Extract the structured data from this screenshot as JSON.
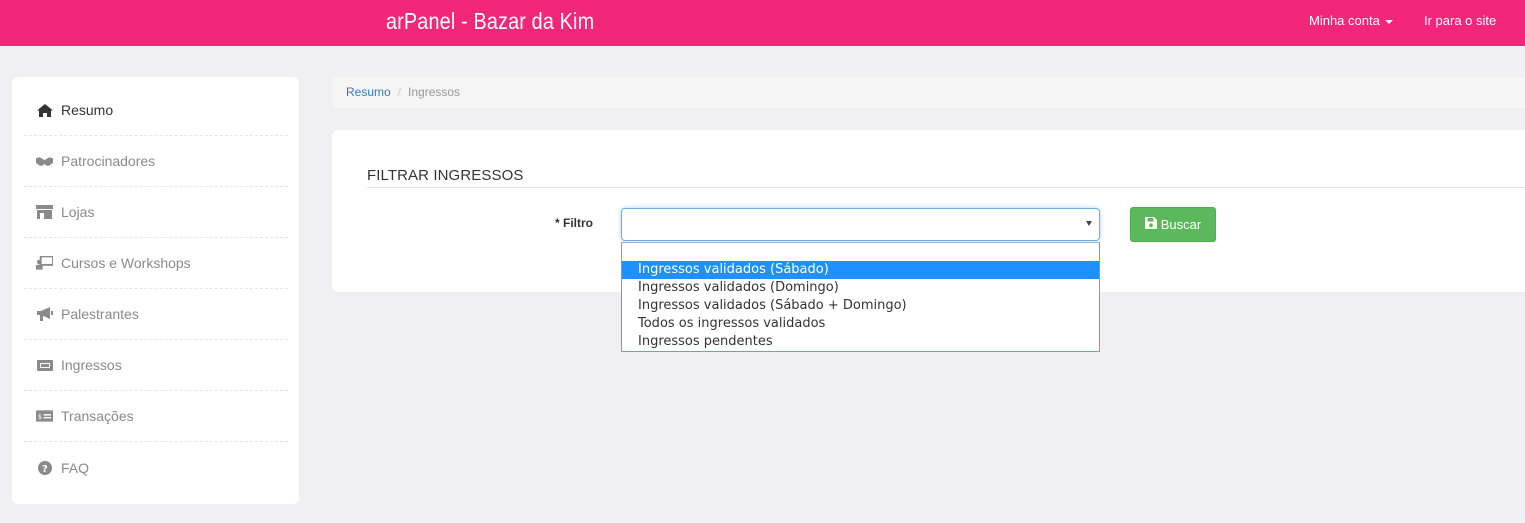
{
  "header": {
    "brand": "arPanel - Bazar da Kim",
    "account_label": "Minha conta",
    "site_label": "Ir para o site"
  },
  "sidebar": {
    "items": [
      {
        "label": "Resumo",
        "icon": "home-icon"
      },
      {
        "label": "Patrocinadores",
        "icon": "handshake-icon"
      },
      {
        "label": "Lojas",
        "icon": "store-icon"
      },
      {
        "label": "Cursos e Workshops",
        "icon": "teacher-icon"
      },
      {
        "label": "Palestrantes",
        "icon": "megaphone-icon"
      },
      {
        "label": "Ingressos",
        "icon": "ticket-icon"
      },
      {
        "label": "Transações",
        "icon": "money-icon"
      },
      {
        "label": "FAQ",
        "icon": "question-icon"
      }
    ]
  },
  "breadcrumb": {
    "home": "Resumo",
    "separator": "/",
    "current": "Ingressos"
  },
  "panel": {
    "title": "FILTRAR INGRESSOS",
    "filter_label": "* Filtro",
    "select_value": "",
    "button_label": "Buscar",
    "options": [
      "Ingressos validados (Sábado)",
      "Ingressos validados (Domingo)",
      "Ingressos validados (Sábado + Domingo)",
      "Todos os ingressos validados",
      "Ingressos pendentes"
    ],
    "highlighted_option": "Ingressos validados (Sábado)"
  },
  "colors": {
    "topbar": "#f2277a",
    "button": "#5cb85c",
    "link": "#337ab7",
    "highlight": "#1e90ff"
  }
}
